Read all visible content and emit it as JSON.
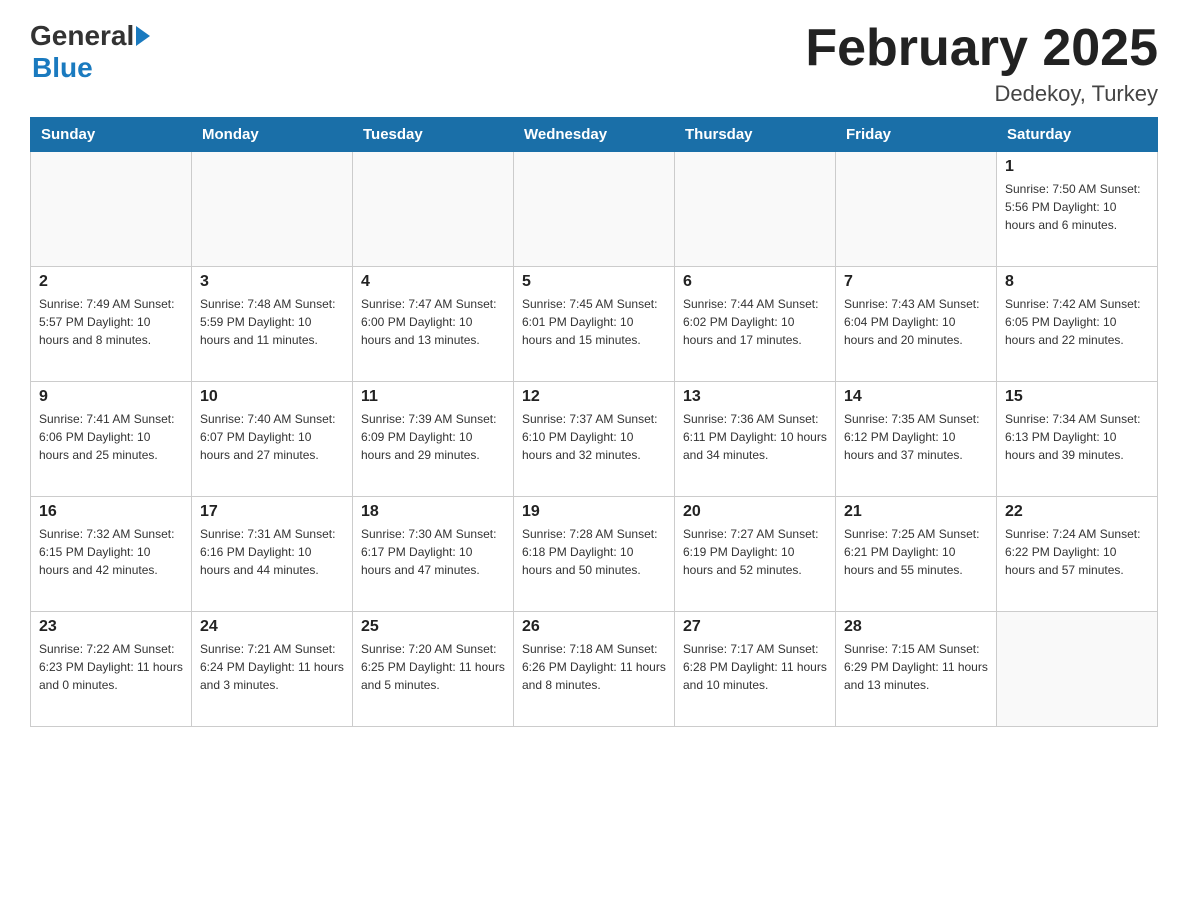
{
  "header": {
    "logo_text": "General",
    "logo_blue": "Blue",
    "title": "February 2025",
    "subtitle": "Dedekoy, Turkey"
  },
  "days_of_week": [
    "Sunday",
    "Monday",
    "Tuesday",
    "Wednesday",
    "Thursday",
    "Friday",
    "Saturday"
  ],
  "weeks": [
    [
      {
        "day": "",
        "info": ""
      },
      {
        "day": "",
        "info": ""
      },
      {
        "day": "",
        "info": ""
      },
      {
        "day": "",
        "info": ""
      },
      {
        "day": "",
        "info": ""
      },
      {
        "day": "",
        "info": ""
      },
      {
        "day": "1",
        "info": "Sunrise: 7:50 AM\nSunset: 5:56 PM\nDaylight: 10 hours and 6 minutes."
      }
    ],
    [
      {
        "day": "2",
        "info": "Sunrise: 7:49 AM\nSunset: 5:57 PM\nDaylight: 10 hours and 8 minutes."
      },
      {
        "day": "3",
        "info": "Sunrise: 7:48 AM\nSunset: 5:59 PM\nDaylight: 10 hours and 11 minutes."
      },
      {
        "day": "4",
        "info": "Sunrise: 7:47 AM\nSunset: 6:00 PM\nDaylight: 10 hours and 13 minutes."
      },
      {
        "day": "5",
        "info": "Sunrise: 7:45 AM\nSunset: 6:01 PM\nDaylight: 10 hours and 15 minutes."
      },
      {
        "day": "6",
        "info": "Sunrise: 7:44 AM\nSunset: 6:02 PM\nDaylight: 10 hours and 17 minutes."
      },
      {
        "day": "7",
        "info": "Sunrise: 7:43 AM\nSunset: 6:04 PM\nDaylight: 10 hours and 20 minutes."
      },
      {
        "day": "8",
        "info": "Sunrise: 7:42 AM\nSunset: 6:05 PM\nDaylight: 10 hours and 22 minutes."
      }
    ],
    [
      {
        "day": "9",
        "info": "Sunrise: 7:41 AM\nSunset: 6:06 PM\nDaylight: 10 hours and 25 minutes."
      },
      {
        "day": "10",
        "info": "Sunrise: 7:40 AM\nSunset: 6:07 PM\nDaylight: 10 hours and 27 minutes."
      },
      {
        "day": "11",
        "info": "Sunrise: 7:39 AM\nSunset: 6:09 PM\nDaylight: 10 hours and 29 minutes."
      },
      {
        "day": "12",
        "info": "Sunrise: 7:37 AM\nSunset: 6:10 PM\nDaylight: 10 hours and 32 minutes."
      },
      {
        "day": "13",
        "info": "Sunrise: 7:36 AM\nSunset: 6:11 PM\nDaylight: 10 hours and 34 minutes."
      },
      {
        "day": "14",
        "info": "Sunrise: 7:35 AM\nSunset: 6:12 PM\nDaylight: 10 hours and 37 minutes."
      },
      {
        "day": "15",
        "info": "Sunrise: 7:34 AM\nSunset: 6:13 PM\nDaylight: 10 hours and 39 minutes."
      }
    ],
    [
      {
        "day": "16",
        "info": "Sunrise: 7:32 AM\nSunset: 6:15 PM\nDaylight: 10 hours and 42 minutes."
      },
      {
        "day": "17",
        "info": "Sunrise: 7:31 AM\nSunset: 6:16 PM\nDaylight: 10 hours and 44 minutes."
      },
      {
        "day": "18",
        "info": "Sunrise: 7:30 AM\nSunset: 6:17 PM\nDaylight: 10 hours and 47 minutes."
      },
      {
        "day": "19",
        "info": "Sunrise: 7:28 AM\nSunset: 6:18 PM\nDaylight: 10 hours and 50 minutes."
      },
      {
        "day": "20",
        "info": "Sunrise: 7:27 AM\nSunset: 6:19 PM\nDaylight: 10 hours and 52 minutes."
      },
      {
        "day": "21",
        "info": "Sunrise: 7:25 AM\nSunset: 6:21 PM\nDaylight: 10 hours and 55 minutes."
      },
      {
        "day": "22",
        "info": "Sunrise: 7:24 AM\nSunset: 6:22 PM\nDaylight: 10 hours and 57 minutes."
      }
    ],
    [
      {
        "day": "23",
        "info": "Sunrise: 7:22 AM\nSunset: 6:23 PM\nDaylight: 11 hours and 0 minutes."
      },
      {
        "day": "24",
        "info": "Sunrise: 7:21 AM\nSunset: 6:24 PM\nDaylight: 11 hours and 3 minutes."
      },
      {
        "day": "25",
        "info": "Sunrise: 7:20 AM\nSunset: 6:25 PM\nDaylight: 11 hours and 5 minutes."
      },
      {
        "day": "26",
        "info": "Sunrise: 7:18 AM\nSunset: 6:26 PM\nDaylight: 11 hours and 8 minutes."
      },
      {
        "day": "27",
        "info": "Sunrise: 7:17 AM\nSunset: 6:28 PM\nDaylight: 11 hours and 10 minutes."
      },
      {
        "day": "28",
        "info": "Sunrise: 7:15 AM\nSunset: 6:29 PM\nDaylight: 11 hours and 13 minutes."
      },
      {
        "day": "",
        "info": ""
      }
    ]
  ]
}
